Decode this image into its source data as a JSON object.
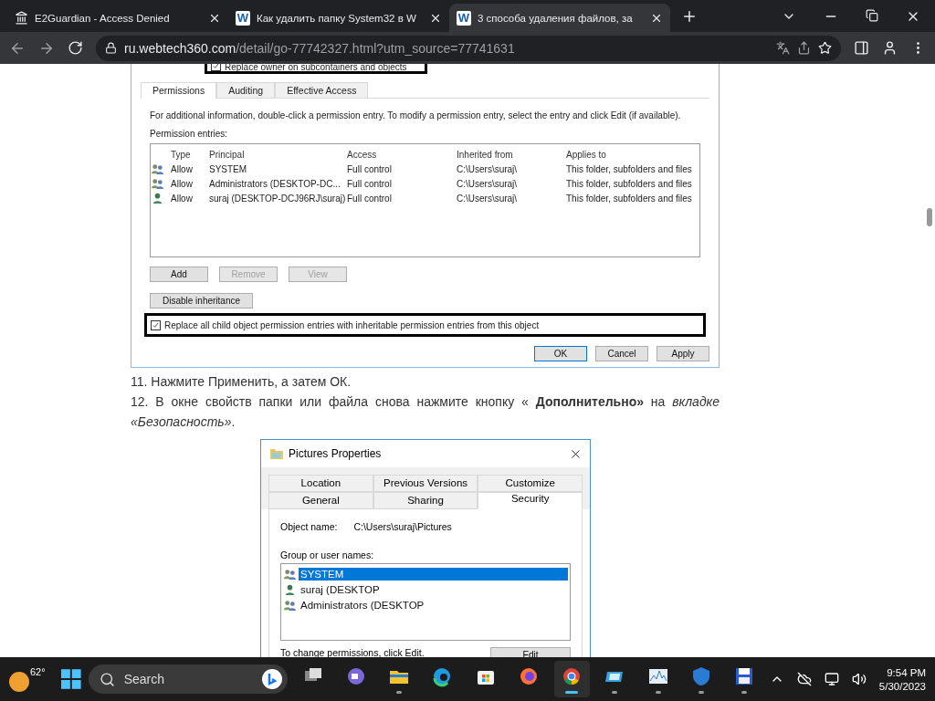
{
  "browser": {
    "tabs": [
      {
        "title": "E2Guardian - Access Denied",
        "selected": false,
        "kind": "museum"
      },
      {
        "title": "Как удалить папку System32 в W",
        "selected": false,
        "kind": "word",
        "logo_text": "W"
      },
      {
        "title": "3 способа удаления файлов, за",
        "selected": true,
        "kind": "word",
        "logo_text": "W"
      }
    ],
    "url_host": "ru.webtech360.com",
    "url_path": "/detail/go-77742327.html?utm_source=77741631"
  },
  "advanced_security_image": {
    "top_option": {
      "label": "Replace owner on subcontainers and objects",
      "checked": true
    },
    "tabs": [
      {
        "label": "Permissions",
        "selected": true
      },
      {
        "label": "Auditing",
        "selected": false
      },
      {
        "label": "Effective Access",
        "selected": false
      }
    ],
    "info": "For additional information, double-click a permission entry. To modify a permission entry, select the entry and click Edit (if available).",
    "entries_label": "Permission entries:",
    "columns": [
      "Type",
      "Principal",
      "Access",
      "Inherited from",
      "Applies to"
    ],
    "rows": [
      {
        "kind": "group",
        "cells": [
          "Allow",
          "SYSTEM",
          "Full control",
          "C:\\Users\\suraj\\",
          "This folder, subfolders and files"
        ]
      },
      {
        "kind": "group",
        "cells": [
          "Allow",
          "Administrators (DESKTOP-DC...",
          "Full control",
          "C:\\Users\\suraj\\",
          "This folder, subfolders and files"
        ]
      },
      {
        "kind": "user",
        "cells": [
          "Allow",
          "suraj (DESKTOP-DCJ96RJ\\suraj)",
          "Full control",
          "C:\\Users\\suraj\\",
          "This folder, subfolders and files"
        ]
      }
    ],
    "buttons": [
      {
        "label": "Add",
        "disabled": false
      },
      {
        "label": "Remove",
        "disabled": true
      },
      {
        "label": "View",
        "disabled": true
      }
    ],
    "disable_inheritance": "Disable inheritance",
    "replace_option": {
      "label": "Replace all child object permission entries with inheritable permission entries from this object",
      "checked": true
    },
    "footer_buttons": [
      {
        "label": "OK",
        "default": true
      },
      {
        "label": "Cancel",
        "default": false
      },
      {
        "label": "Apply",
        "default": false
      }
    ]
  },
  "steps": [
    "11. Нажмите Применить, а затем ОК.",
    "12. В окне свойств папки или файла снова нажмите кнопку « **Дополнительно»** на *вкладке «Безопасность»*."
  ],
  "properties_image": {
    "title": "Pictures Properties",
    "tab_rows": [
      [
        {
          "label": "Location",
          "selected": false
        },
        {
          "label": "Previous Versions",
          "selected": false
        },
        {
          "label": "Customize",
          "selected": false
        }
      ],
      [
        {
          "label": "General",
          "selected": false
        },
        {
          "label": "Sharing",
          "selected": false
        },
        {
          "label": "Security",
          "selected": true
        }
      ]
    ],
    "object_name_label": "Object name:",
    "object_name": "C:\\Users\\suraj\\Pictures",
    "group_label": "Group or user names:",
    "users": [
      {
        "name": "SYSTEM",
        "kind": "group",
        "selected": true
      },
      {
        "name": "suraj (DESKTOP",
        "kind": "user",
        "selected": false
      },
      {
        "name": "Administrators (DESKTOP",
        "kind": "group",
        "selected": false
      }
    ],
    "change_hint": "To change permissions, click Edit.",
    "edit_button": "Edit"
  },
  "taskbar": {
    "weather": "62°",
    "search_placeholder": "Search",
    "apps": [
      {
        "kind": "taskview",
        "running": false,
        "selected": false
      },
      {
        "kind": "chat",
        "running": false,
        "selected": false
      },
      {
        "kind": "explorer",
        "running": true,
        "selected": false
      },
      {
        "kind": "edge",
        "running": false,
        "selected": false
      },
      {
        "kind": "store",
        "running": false,
        "selected": false
      },
      {
        "kind": "firefox",
        "running": false,
        "selected": false
      },
      {
        "kind": "chrome",
        "running": true,
        "selected": true
      },
      {
        "kind": "tablet",
        "running": true,
        "selected": false
      },
      {
        "kind": "monitor",
        "running": true,
        "selected": false
      },
      {
        "kind": "shield",
        "running": true,
        "selected": false
      },
      {
        "kind": "disk",
        "running": true,
        "selected": false
      }
    ],
    "time": "9:54 PM",
    "date": "5/30/2023"
  }
}
